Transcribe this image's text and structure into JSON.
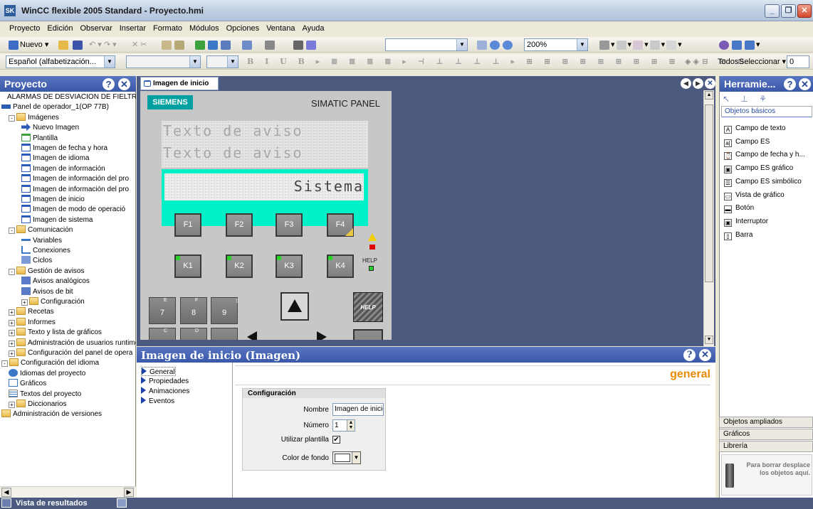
{
  "window": {
    "title": "WinCC flexible 2005 Standard - Proyecto.hmi",
    "app_icon": "SK"
  },
  "menu": [
    "Proyecto",
    "Edición",
    "Observar",
    "Insertar",
    "Formato",
    "Módulos",
    "Opciones",
    "Ventana",
    "Ayuda"
  ],
  "toolbar1": {
    "new_label": "Nuevo",
    "zoom": "200%"
  },
  "toolbar2": {
    "language": "Español (alfabetización...",
    "todos": "Todos",
    "seleccionar": "Seleccionar",
    "number": "0"
  },
  "project": {
    "title": "Proyecto",
    "tree": [
      {
        "label": "ALARMAS DE DESVIACION DE FIELTR",
        "level": 0,
        "icon": "none"
      },
      {
        "label": "Panel de operador_1(OP 77B)",
        "level": 0,
        "icon": "panel"
      },
      {
        "label": "Imágenes",
        "level": 1,
        "icon": "folder",
        "exp": "-"
      },
      {
        "label": "Nuevo Imagen",
        "level": 2,
        "icon": "new"
      },
      {
        "label": "Plantilla",
        "level": 2,
        "icon": "tmpl"
      },
      {
        "label": "Imagen de fecha y hora",
        "level": 2,
        "icon": "screen"
      },
      {
        "label": "Imagen de idioma",
        "level": 2,
        "icon": "screen"
      },
      {
        "label": "Imagen de información",
        "level": 2,
        "icon": "screen"
      },
      {
        "label": "Imagen de información del pro",
        "level": 2,
        "icon": "screen"
      },
      {
        "label": "Imagen de información del pro",
        "level": 2,
        "icon": "screen"
      },
      {
        "label": "Imagen de inicio",
        "level": 2,
        "icon": "screen"
      },
      {
        "label": "Imagen de modo de operació",
        "level": 2,
        "icon": "screen"
      },
      {
        "label": "Imagen de sistema",
        "level": 2,
        "icon": "screen"
      },
      {
        "label": "Comunicación",
        "level": 1,
        "icon": "folder",
        "exp": "-"
      },
      {
        "label": "Variables",
        "level": 2,
        "icon": "var"
      },
      {
        "label": "Conexiones",
        "level": 2,
        "icon": "conn"
      },
      {
        "label": "Ciclos",
        "level": 2,
        "icon": "cycle"
      },
      {
        "label": "Gestión de avisos",
        "level": 1,
        "icon": "folder",
        "exp": "-"
      },
      {
        "label": "Avisos analógicos",
        "level": 2,
        "icon": "alarm"
      },
      {
        "label": "Avisos de bit",
        "level": 2,
        "icon": "alarm"
      },
      {
        "label": "Configuración",
        "level": 2,
        "icon": "folder",
        "exp": "+"
      },
      {
        "label": "Recetas",
        "level": 1,
        "icon": "folder",
        "exp": "+"
      },
      {
        "label": "Informes",
        "level": 1,
        "icon": "folder",
        "exp": "+"
      },
      {
        "label": "Texto y lista de gráficos",
        "level": 1,
        "icon": "folder",
        "exp": "+"
      },
      {
        "label": "Administración de usuarios runtime",
        "level": 1,
        "icon": "folder",
        "exp": "+"
      },
      {
        "label": "Configuración del panel de opera",
        "level": 1,
        "icon": "folder",
        "exp": "+"
      },
      {
        "label": "Configuración del idioma",
        "level": 0,
        "icon": "folder",
        "exp": "-"
      },
      {
        "label": "Idiomas del proyecto",
        "level": 1,
        "icon": "globe"
      },
      {
        "label": "Gráficos",
        "level": 1,
        "icon": "gfx"
      },
      {
        "label": "Textos del proyecto",
        "level": 1,
        "icon": "text"
      },
      {
        "label": "Diccionarios",
        "level": 1,
        "icon": "folder",
        "exp": "+"
      },
      {
        "label": "Administración de versiones",
        "level": 0,
        "icon": "folder"
      }
    ]
  },
  "editor": {
    "tab": "Imagen de inicio",
    "panel": {
      "brand": "SIEMENS",
      "model": "SIMATIC PANEL",
      "line1": "Texto de aviso",
      "line2": "Texto de aviso",
      "line3": "Sistema",
      "fkeys": [
        "F1",
        "F2",
        "F3",
        "F4"
      ],
      "kkeys": [
        "K1",
        "K2",
        "K3",
        "K4"
      ],
      "help": "HELP",
      "numkeys": [
        "7",
        "8",
        "9"
      ],
      "numsup": [
        "E",
        "F"
      ],
      "numsup2": [
        "C",
        "D"
      ],
      "help_key": "HELP"
    }
  },
  "properties": {
    "title": "Imagen de inicio (Imagen)",
    "nav": [
      "General",
      "Propiedades",
      "Animaciones",
      "Eventos"
    ],
    "section_title": "general",
    "group_title": "Configuración",
    "name_label": "Nombre",
    "name_value": "Imagen de inicio",
    "number_label": "Número",
    "number_value": "1",
    "template_label": "Utilizar plantilla",
    "template_checked": "✔",
    "bgcolor_label": "Color de fondo"
  },
  "tools": {
    "title": "Herramie...",
    "tab_basic": "Objetos básicos",
    "items": [
      "Campo de texto",
      "Campo ES",
      "Campo de fecha y h...",
      "Campo ES gráfico",
      "Campo ES simbólico",
      "Vista de gráfico",
      "Botón",
      "Interruptor",
      "Barra"
    ],
    "icons": [
      "A",
      "a|",
      "⌚",
      "▣",
      "☰",
      "▭",
      "▬",
      "▣",
      "▯"
    ],
    "sections": [
      "Objetos ampliados",
      "Gráficos",
      "Librería"
    ],
    "trash_text": "Para borrar desplace los objetos aquí."
  },
  "statusbar": {
    "label": "Vista de resultados"
  }
}
